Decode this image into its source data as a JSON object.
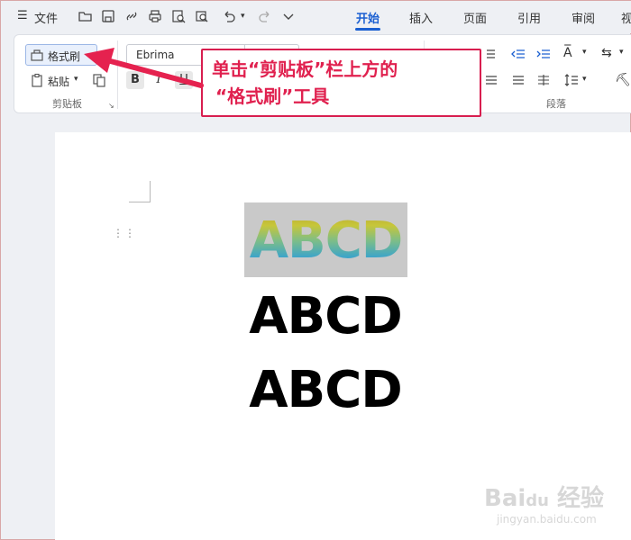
{
  "menubar": {
    "file_label": "文件",
    "tabs": [
      {
        "label": "开始",
        "active": true
      },
      {
        "label": "插入"
      },
      {
        "label": "页面"
      },
      {
        "label": "引用"
      },
      {
        "label": "审阅"
      },
      {
        "label": "视"
      }
    ]
  },
  "ribbon": {
    "format_painter_label": "格式刷",
    "paste_label": "粘贴",
    "clipboard_group_label": "剪贴板",
    "font_name": "Ebrima",
    "bold_label": "B",
    "italic_label": "I",
    "underline_label": "U",
    "paragraph_group_label": "段落"
  },
  "document": {
    "lines": [
      "ABCD",
      "ABCD",
      "ABCD"
    ]
  },
  "annotation": {
    "line1": "单击“剪贴板”栏上方的",
    "line2": "“格式刷”工具"
  },
  "colors": {
    "accent": "#1a5fd1",
    "annotation_red": "#d81e4f"
  }
}
